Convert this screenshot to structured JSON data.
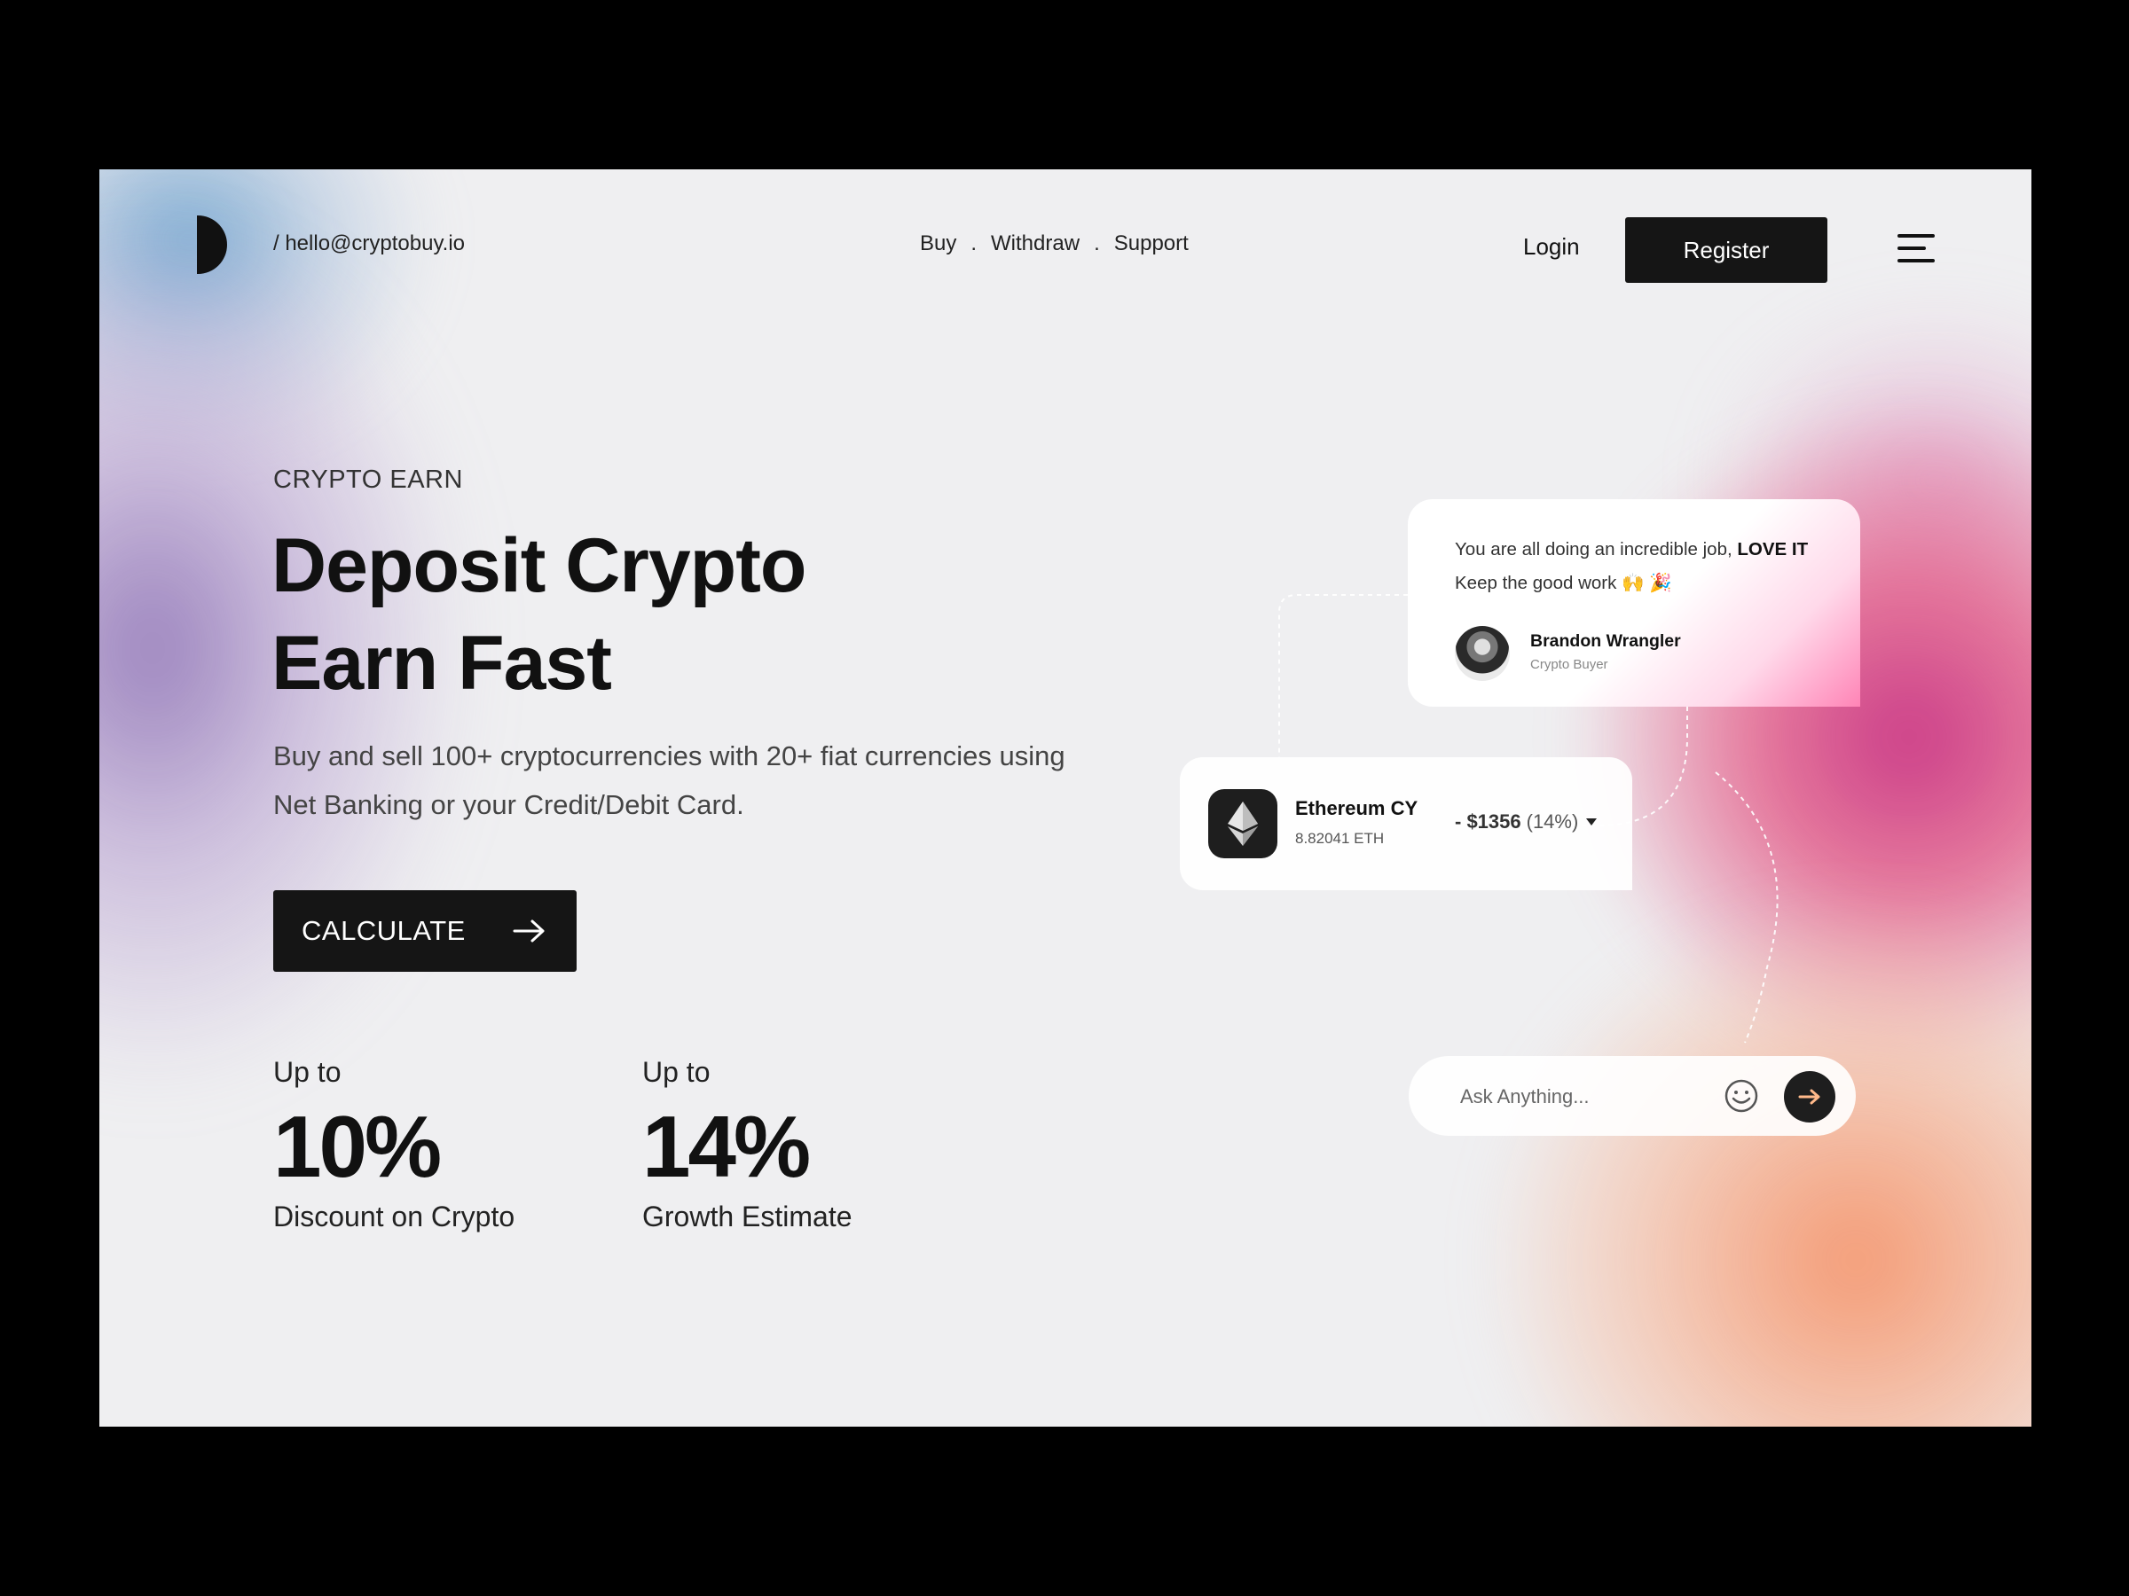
{
  "header": {
    "email": "/ hello@cryptobuy.io",
    "nav": [
      {
        "label": "Buy"
      },
      {
        "label": "Withdraw"
      },
      {
        "label": "Support"
      }
    ],
    "nav_separator": ".",
    "login_label": "Login",
    "register_label": "Register"
  },
  "hero": {
    "eyebrow": "CRYPTO EARN",
    "headline_line1": "Deposit Crypto",
    "headline_line2": "Earn Fast",
    "description": "Buy and sell 100+ cryptocurrencies with 20+ fiat currencies using Net Banking or your Credit/Debit Card.",
    "cta_label": "CALCULATE"
  },
  "stats": [
    {
      "prefix": "Up to",
      "value": "10%",
      "label": "Discount on Crypto"
    },
    {
      "prefix": "Up to",
      "value": "14%",
      "label": "Growth Estimate"
    }
  ],
  "testimonial": {
    "text_before": "You are all doing an incredible job,",
    "text_bold": "LOVE IT",
    "text_line2": "Keep the good work",
    "emojis": "🙌 🎉",
    "name": "Brandon Wrangler",
    "role": "Crypto Buyer"
  },
  "coin": {
    "name": "Ethereum CY",
    "amount": "8.82041 ETH",
    "change": "- $1356",
    "change_pct": "(14%)",
    "icon": "ethereum-icon"
  },
  "chat": {
    "placeholder": "Ask Anything..."
  },
  "colors": {
    "dark": "#151515",
    "background": "#efeff1",
    "accent_pink": "#c83282",
    "accent_orange": "#f4966e"
  }
}
